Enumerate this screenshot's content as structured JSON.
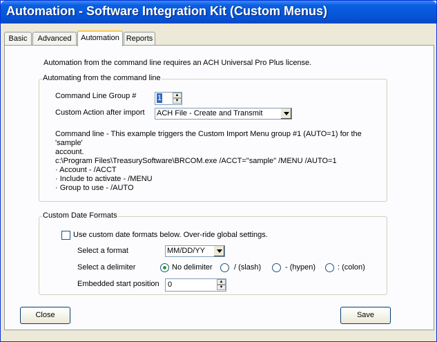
{
  "window": {
    "title": "Automation - Software Integration Kit (Custom Menus)"
  },
  "tabs": [
    "Basic",
    "Advanced",
    "Automation",
    "Reports"
  ],
  "active_tab": "Automation",
  "license_note": "Automation from the command line requires an ACH Universal Pro Plus license.",
  "command_line_group": {
    "legend": "Automating from the command line",
    "group_label": "Command Line Group #",
    "group_value": "1",
    "action_label": "Custom Action after import",
    "action_value": "ACH File - Create and Transmit",
    "description": "Command line - This example triggers the Custom Import Menu group #1 (AUTO=1) for the 'sample'\naccount.\nc:\\Program Files\\TreasurySoftware\\BRCOM.exe /ACCT=\"sample\" /MENU /AUTO=1",
    "bullets": "· Account - /ACCT\n· Include to activate - /MENU\n· Group to use - /AUTO"
  },
  "date_formats": {
    "legend": "Custom Date Formats",
    "checkbox_label": "Use custom date formats below.  Over-ride global settings.",
    "checkbox_checked": false,
    "format_label": "Select a format",
    "format_value": "MM/DD/YY",
    "delimiter_label": "Select a delimiter",
    "delimiters": [
      "No delimiter",
      "/ (slash)",
      "- (hypen)",
      ": (colon)"
    ],
    "selected_delimiter": "No delimiter",
    "start_label": "Embedded start position",
    "start_value": "0"
  },
  "buttons": {
    "close": "Close",
    "save": "Save"
  }
}
